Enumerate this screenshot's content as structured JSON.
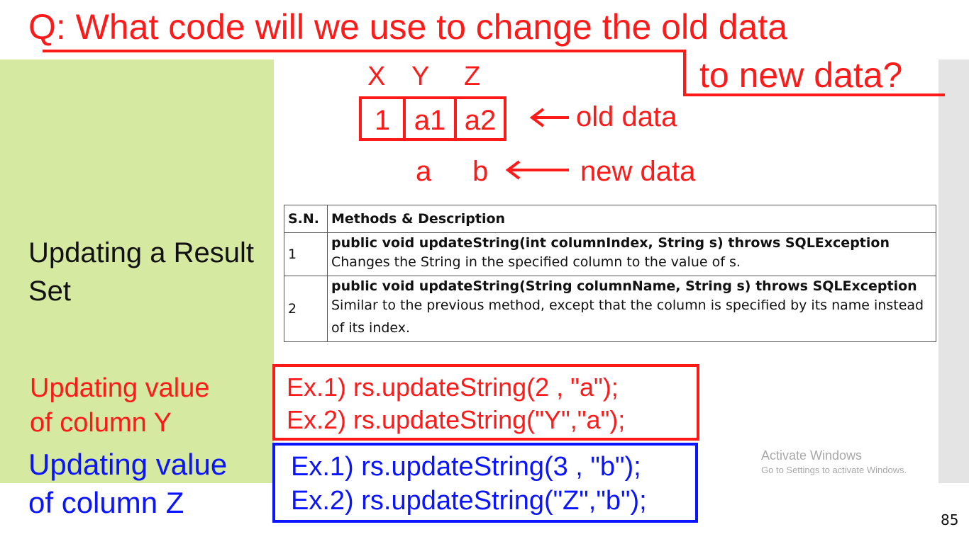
{
  "question": {
    "line1": "Q: What code will we use to change the old data",
    "line2": "to new data?"
  },
  "columns": [
    "X",
    "Y",
    "Z"
  ],
  "old_data": [
    "1",
    "a1",
    "a2"
  ],
  "old_label": "old data",
  "new_data": [
    "a",
    "b"
  ],
  "new_label": "new data",
  "slide_title": "Updating a Result Set",
  "table": {
    "headers": [
      "S.N.",
      "Methods & Description"
    ],
    "rows": [
      {
        "sn": "1",
        "signature": "public void updateString(int columnIndex, String s) throws SQLException",
        "description": "Changes the String in the specified column to the value of s."
      },
      {
        "sn": "2",
        "signature": "public void updateString(String columnName, String s) throws SQLException",
        "description": "Similar to the previous method, except that the column is specified by its name instead of its index."
      }
    ]
  },
  "column_y": {
    "label_line1": "Updating value",
    "label_line2": "of column Y",
    "ex1": "Ex.1) rs.updateString(2 , \"a\");",
    "ex2": "Ex.2) rs.updateString(\"Y\",\"a\");"
  },
  "column_z": {
    "label_line1": "Updating value",
    "label_line2": "of column Z",
    "ex1": "Ex.1) rs.updateString(3 , \"b\");",
    "ex2": "Ex.2) rs.updateString(\"Z\",\"b\");"
  },
  "watermark": {
    "title": "Activate Windows",
    "subtitle": "Go to Settings to activate Windows."
  },
  "page_number": "85",
  "colors": {
    "annotation_red": "#ff1a1a",
    "annotation_blue": "#0a14ff",
    "panel_green": "#d6e9a0"
  },
  "icons": [
    "arrow-left-icon",
    "arrow-left-icon"
  ]
}
